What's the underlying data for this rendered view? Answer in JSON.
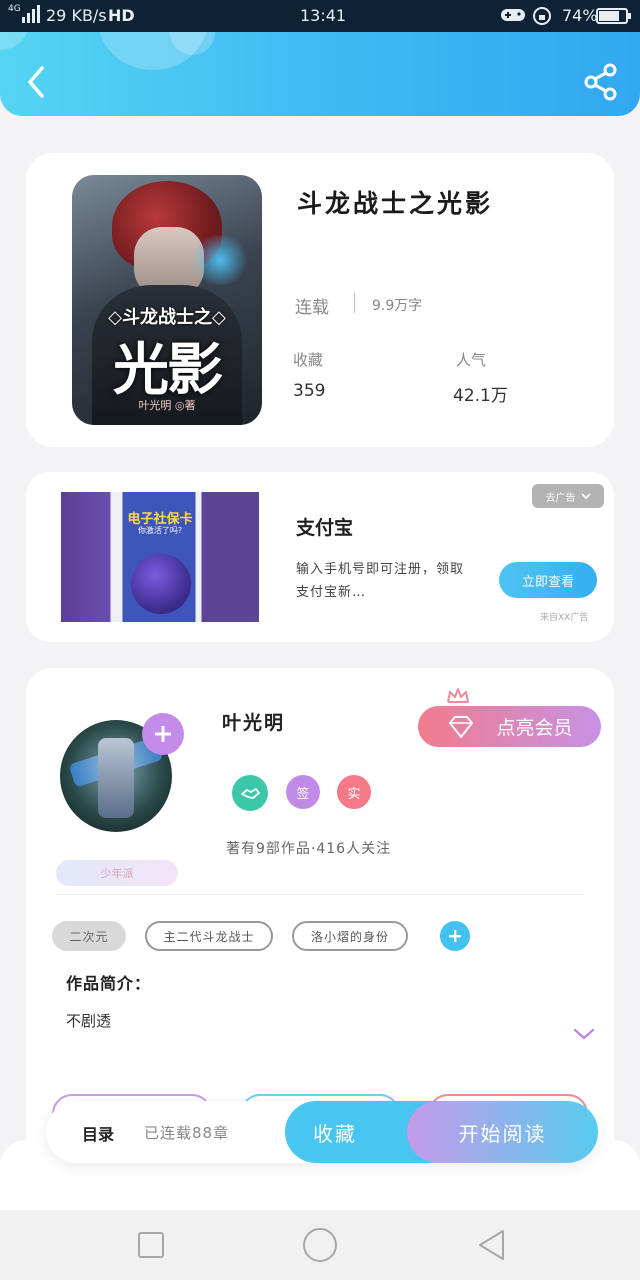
{
  "status_bar": {
    "network": "4G",
    "speed": "29 KB/s",
    "hd": "HD",
    "time": "13:41",
    "battery": "74%"
  },
  "header": {
    "back_icon": "chevron-left-icon",
    "share_icon": "share-icon"
  },
  "book": {
    "cover_subtitle": "◇斗龙战士之◇",
    "cover_title": "光影",
    "cover_author": "叶光明 ◎著",
    "title": "斗龙战士之光影",
    "status": "连载",
    "word_count": "9.9万字",
    "favorites_label": "收藏",
    "favorites_value": "359",
    "popularity_label": "人气",
    "popularity_value": "42.1万"
  },
  "ad": {
    "dismiss_label": "去广告",
    "image_title": "电子社保卡",
    "image_subtitle": "你激活了吗?",
    "title": "支付宝",
    "description": "输入手机号即可注册，领取支付宝新…",
    "cta": "立即查看",
    "source": "来自XX广告"
  },
  "author": {
    "name": "叶光明",
    "vip_button": "点亮会员",
    "badge_sign": "签",
    "badge_real": "实",
    "stats": "著有9部作品·416人关注",
    "level": "少年派"
  },
  "tags": [
    "二次元",
    "主二代斗龙战士",
    "洛小熠的身份"
  ],
  "intro": {
    "label": "作品简介：",
    "text": "不剧透"
  },
  "bottom_bar": {
    "catalog_label": "目录",
    "chapter_status": "已连载88章",
    "favorite_button": "收藏",
    "read_button": "开始阅读"
  },
  "colors": {
    "header_gradient_start": "#55d4f3",
    "header_gradient_end": "#31a8f0",
    "favorite_button": "#48c6f1",
    "read_button_start": "#c59ae8",
    "read_button_end": "#58ccef",
    "vip_start": "#f27b8c",
    "vip_end": "#c692e6",
    "badge_purple": "#c08be6",
    "badge_red": "#f37a86",
    "badge_teal": "#3cc7a8"
  }
}
